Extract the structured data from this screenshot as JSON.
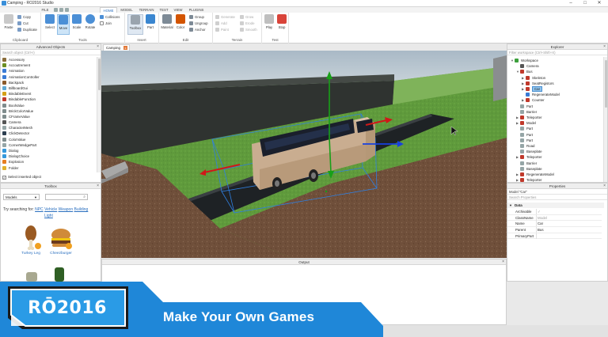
{
  "window": {
    "title": "Camping - RO2016 Studio",
    "minimize": "–",
    "maximize": "□",
    "close": "✕"
  },
  "ribbon_tabs": {
    "file": "FILE",
    "home": "HOME",
    "model": "MODEL",
    "terrain": "TERRAIN",
    "test": "TEST",
    "view": "VIEW",
    "plugins": "PLUGINS"
  },
  "ribbon": {
    "clipboard": {
      "label": "Clipboard",
      "paste": "Paste",
      "copy": "Copy",
      "cut": "Cut",
      "duplicate": "Duplicate"
    },
    "tools": {
      "label": "Tools",
      "select": "Select",
      "move": "Move",
      "scale": "Scale",
      "rotate": "Rotate",
      "collisions": "Collisions",
      "join": "Join"
    },
    "insert": {
      "label": "Insert",
      "toolbox": "Toolbox",
      "part": "Part"
    },
    "edit": {
      "label": "Edit",
      "material": "Material",
      "color": "Color",
      "group": "Group",
      "ungroup": "Ungroup",
      "anchor": "Anchor"
    },
    "terrain": {
      "label": "Terrain",
      "generate": "Generate",
      "add": "Add",
      "paint": "Paint",
      "grow": "Grow",
      "erode": "Erode",
      "smooth": "Smooth"
    },
    "test": {
      "label": "Test",
      "play": "Play",
      "stop": "Stop"
    }
  },
  "advanced_objects": {
    "title": "Advanced Objects",
    "search_placeholder": "Search object (Ctrl+I)",
    "items": [
      {
        "label": "Accessory",
        "color": "#8a6d3b"
      },
      {
        "label": "Accoutrement",
        "color": "#6b8e23"
      },
      {
        "label": "Animation",
        "color": "#3a7bd5"
      },
      {
        "label": "AnimationController",
        "color": "#3a7bd5"
      },
      {
        "label": "Backpack",
        "color": "#8b5a2b"
      },
      {
        "label": "BillboardGui",
        "color": "#5fa8d3"
      },
      {
        "label": "BindableEvent",
        "color": "#d4a017"
      },
      {
        "label": "BindableFunction",
        "color": "#c0392b"
      },
      {
        "label": "BoolValue",
        "color": "#7f8c8d"
      },
      {
        "label": "BrickColorValue",
        "color": "#7f8c8d"
      },
      {
        "label": "CFrameValue",
        "color": "#7f8c8d"
      },
      {
        "label": "Camera",
        "color": "#555555"
      },
      {
        "label": "CharacterMesh",
        "color": "#95a5a6"
      },
      {
        "label": "ClickDetector",
        "color": "#2c3e50"
      },
      {
        "label": "ColorValue",
        "color": "#7f8c8d"
      },
      {
        "label": "CornerWedgePart",
        "color": "#95a5a6"
      },
      {
        "label": "Dialog",
        "color": "#3498db"
      },
      {
        "label": "DialogChoice",
        "color": "#3498db"
      },
      {
        "label": "Explosion",
        "color": "#e67e22"
      },
      {
        "label": "Folder",
        "color": "#e1b12c"
      }
    ],
    "footer": "Select inserted object"
  },
  "toolbox": {
    "title": "Toolbox",
    "category": "Models",
    "try_label": "Try searching for:",
    "suggestions": [
      "NPC",
      "Vehicle",
      "Weapon",
      "Building",
      "Light"
    ],
    "items": [
      {
        "label": "Turkey Leg"
      },
      {
        "label": "Cheezburger"
      }
    ]
  },
  "viewport_tab": {
    "label": "Camping",
    "close": "x"
  },
  "output": {
    "title": "Output"
  },
  "explorer": {
    "title": "Explorer",
    "filter_placeholder": "Filter workspace (Ctrl+Shift+X)",
    "items": [
      {
        "label": "Workspace",
        "depth": 0,
        "arrow": "▼",
        "color": "#3ca03c"
      },
      {
        "label": "Camera",
        "depth": 1,
        "arrow": "",
        "color": "#555555"
      },
      {
        "label": "Bus",
        "depth": 1,
        "arrow": "▼",
        "color": "#c0392b"
      },
      {
        "label": "Skeleton",
        "depth": 2,
        "arrow": "▶",
        "color": "#c0392b"
      },
      {
        "label": "SeatRegistors",
        "depth": 2,
        "arrow": "▶",
        "color": "#c0392b"
      },
      {
        "label": "Car",
        "depth": 2,
        "arrow": "▶",
        "color": "#c0392b",
        "selected": true
      },
      {
        "label": "RegenerateModel",
        "depth": 2,
        "arrow": "",
        "color": "#3a7bd5"
      },
      {
        "label": "Counter",
        "depth": 2,
        "arrow": "▶",
        "color": "#c0392b"
      },
      {
        "label": "Part",
        "depth": 1,
        "arrow": "",
        "color": "#95a5a6"
      },
      {
        "label": "Barrier",
        "depth": 1,
        "arrow": "",
        "color": "#95a5a6"
      },
      {
        "label": "Teleporter",
        "depth": 1,
        "arrow": "▶",
        "color": "#c0392b"
      },
      {
        "label": "Model",
        "depth": 1,
        "arrow": "▶",
        "color": "#c0392b"
      },
      {
        "label": "Part",
        "depth": 1,
        "arrow": "",
        "color": "#95a5a6"
      },
      {
        "label": "Part",
        "depth": 1,
        "arrow": "",
        "color": "#95a5a6"
      },
      {
        "label": "Part",
        "depth": 1,
        "arrow": "",
        "color": "#95a5a6"
      },
      {
        "label": "Road",
        "depth": 1,
        "arrow": "",
        "color": "#95a5a6"
      },
      {
        "label": "Baseplate",
        "depth": 1,
        "arrow": "",
        "color": "#95a5a6"
      },
      {
        "label": "Teleporter",
        "depth": 1,
        "arrow": "▶",
        "color": "#c0392b"
      },
      {
        "label": "Barrier",
        "depth": 1,
        "arrow": "",
        "color": "#95a5a6"
      },
      {
        "label": "Baseplate",
        "depth": 1,
        "arrow": "",
        "color": "#95a5a6"
      },
      {
        "label": "RegenerateModel",
        "depth": 1,
        "arrow": "▶",
        "color": "#c0392b"
      },
      {
        "label": "Teleporter",
        "depth": 1,
        "arrow": "▶",
        "color": "#c0392b"
      }
    ]
  },
  "properties": {
    "title": "Properties",
    "subtitle": "Model \"Car\"",
    "search_placeholder": "Search Properties",
    "section": "Data",
    "rows": [
      {
        "key": "Archivable",
        "value": "✓",
        "gray": true
      },
      {
        "key": "ClassName",
        "value": "Model",
        "gray": true
      },
      {
        "key": "Name",
        "value": "Car",
        "gray": false
      },
      {
        "key": "Parent",
        "value": "Bus",
        "gray": false
      },
      {
        "key": "PrimaryPart",
        "value": "",
        "gray": false
      }
    ]
  },
  "banner": {
    "logo": "RŌ2016",
    "tagline": "Make Your Own Games"
  }
}
